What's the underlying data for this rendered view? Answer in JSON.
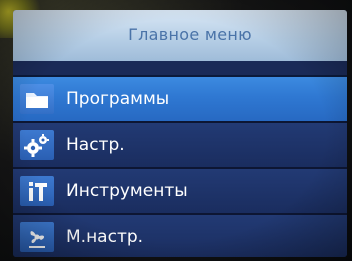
{
  "screen": {
    "title": "Главное меню"
  },
  "menu": {
    "items": [
      {
        "label": "Программы",
        "icon": "folder-icon",
        "selected": true
      },
      {
        "label": "Настр.",
        "icon": "gears-icon",
        "selected": false
      },
      {
        "label": "Инструменты",
        "icon": "tools-icon",
        "selected": false
      },
      {
        "label": "М.настр.",
        "icon": "fan-icon",
        "selected": false
      }
    ]
  },
  "colors": {
    "title_bar": "#b7cfe6",
    "title_text": "#4a73a8",
    "item_selected": "#2f78d2",
    "item_normal": "#1a2d5f",
    "label_text": "#ffffff"
  }
}
